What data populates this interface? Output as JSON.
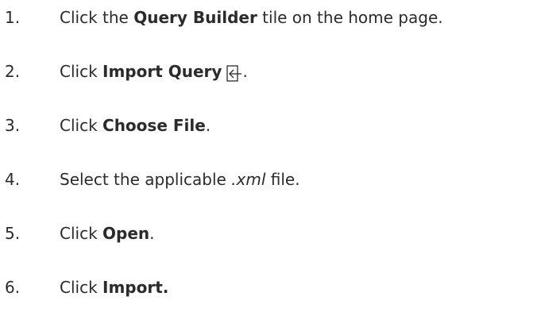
{
  "steps": [
    {
      "number": "1.",
      "verb": "Click the",
      "bold": "Query Builder",
      "rest": "tile on the home page."
    },
    {
      "number": "2.",
      "verb": "Click",
      "bold": "Import Query",
      "icon": "import-icon",
      "rest": "."
    },
    {
      "number": "3.",
      "verb": "Click",
      "bold": "Choose File",
      "rest": "."
    },
    {
      "number": "4.",
      "verb": "Select the applicable",
      "italic": ".xml",
      "rest": "file."
    },
    {
      "number": "5.",
      "verb": "Click",
      "bold": "Open",
      "rest": "."
    },
    {
      "number": "6.",
      "verb": "Click",
      "bold": "Import."
    }
  ]
}
